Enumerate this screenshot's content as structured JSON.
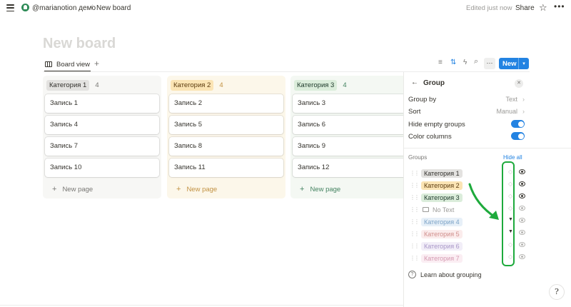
{
  "topbar": {
    "workspace": "@marianotion демо",
    "separator": "/",
    "page": "New board",
    "edited": "Edited just now",
    "share": "Share",
    "star_icon": "☆",
    "more_icon": "•••"
  },
  "page_title": "New board",
  "view": {
    "tab_label": "Board view",
    "add_icon": "+",
    "filter_icon": "≡",
    "sort_icon": "⇅",
    "automation_icon": "ϟ",
    "search_icon": "⌕",
    "more_icon": "···",
    "new_label": "New",
    "new_caret": "▾"
  },
  "columns": [
    {
      "tag": "Категория 1",
      "count": "4",
      "tag_bg": "#e3e2e0",
      "tag_fg": "#32302c",
      "col_bg": "#f7f7f5",
      "count_fg": "#787774",
      "new_fg": "#787774",
      "cards": [
        "Запись 1",
        "Запись 4",
        "Запись 7",
        "Запись 10"
      ],
      "new_page": "New page"
    },
    {
      "tag": "Категория 2",
      "count": "4",
      "tag_bg": "#fbe4b4",
      "tag_fg": "#5c3b0f",
      "col_bg": "#fcf7ea",
      "count_fg": "#c29243",
      "new_fg": "#c29243",
      "cards": [
        "Запись 2",
        "Запись 5",
        "Запись 8",
        "Запись 11"
      ],
      "new_page": "New page"
    },
    {
      "tag": "Категория 3",
      "count": "4",
      "tag_bg": "#dbeddb",
      "tag_fg": "#1c3829",
      "col_bg": "#f4f8f3",
      "count_fg": "#448361",
      "new_fg": "#448361",
      "cards": [
        "Запись 3",
        "Запись 6",
        "Запись 9",
        "Запись 12"
      ],
      "new_page": "New page"
    }
  ],
  "panel": {
    "back_icon": "←",
    "title": "Group",
    "close_icon": "✕",
    "group_by": {
      "label": "Group by",
      "value": "Text"
    },
    "sort": {
      "label": "Sort",
      "value": "Manual"
    },
    "hide_empty": {
      "label": "Hide empty groups",
      "on": true
    },
    "color_columns": {
      "label": "Color columns",
      "on": true
    },
    "groups_label": "Groups",
    "hide_all": "Hide all",
    "groups": [
      {
        "label": "Категория 1",
        "bg": "#e3e2e0",
        "fg": "#32302c",
        "pinned": false,
        "visible": true
      },
      {
        "label": "Категория 2",
        "bg": "#fbe4b4",
        "fg": "#5c3b0f",
        "pinned": false,
        "visible": true
      },
      {
        "label": "Категория 3",
        "bg": "#dbeddb",
        "fg": "#1c3829",
        "pinned": false,
        "visible": true
      },
      {
        "label": "No Text",
        "bg": "",
        "fg": "#9b9a97",
        "pinned": false,
        "visible": false,
        "no_text": true
      },
      {
        "label": "Категория 4",
        "bg": "#e7f0f8",
        "fg": "#7ca3c7",
        "pinned": true,
        "visible": false
      },
      {
        "label": "Категория 5",
        "bg": "#fbecec",
        "fg": "#d08f8c",
        "pinned": true,
        "visible": false
      },
      {
        "label": "Категория 6",
        "bg": "#f2eef8",
        "fg": "#a896c7",
        "pinned": false,
        "visible": false
      },
      {
        "label": "Категория 7",
        "bg": "#fbeef3",
        "fg": "#d499b0",
        "pinned": false,
        "visible": false
      }
    ],
    "learn": "Learn about grouping"
  },
  "help_icon": "?",
  "colors": {
    "accent": "#2383e2",
    "annotation": "#1eaa3c"
  }
}
